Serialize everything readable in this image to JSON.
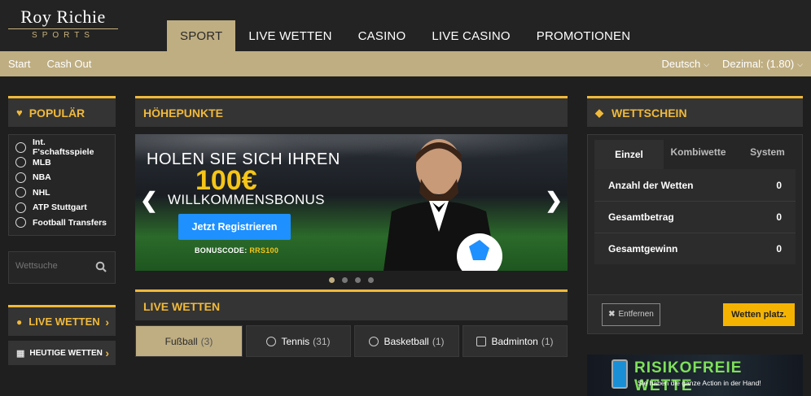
{
  "brand": {
    "name": "Roy Richie",
    "sub": "SPORTS"
  },
  "main_nav": [
    "SPORT",
    "LIVE WETTEN",
    "CASINO",
    "LIVE CASINO",
    "PROMOTIONEN"
  ],
  "sub_nav": {
    "left": [
      "Start",
      "Cash Out"
    ],
    "language": "Deutsch",
    "odds_format": "Dezimal: (1.80)"
  },
  "left": {
    "popular_title": "POPULÄR",
    "popular": [
      {
        "label": "Int. F'schaftsspiele",
        "icon": "soccer-ball-icon"
      },
      {
        "label": "MLB",
        "icon": "baseball-icon"
      },
      {
        "label": "NBA",
        "icon": "basketball-icon"
      },
      {
        "label": "NHL",
        "icon": "hockey-puck-icon"
      },
      {
        "label": "ATP Stuttgart",
        "icon": "tennis-ball-icon"
      },
      {
        "label": "Football Transfers",
        "icon": "soccer-ball-icon"
      }
    ],
    "search_placeholder": "Wettsuche",
    "live_btn": "LIVE WETTEN",
    "today_btn": "HEUTIGE WETTEN"
  },
  "center": {
    "highlights_title": "HÖHEPUNKTE",
    "banner": {
      "title": "HOLEN SIE SICH IHREN",
      "amount": "100€",
      "subtitle": "WILLKOMMENSBONUS",
      "cta": "Jetzt Registrieren",
      "bonus_label": "BONUSCODE:",
      "bonus_code": "RRS100"
    },
    "slides": 4,
    "live_title": "LIVE WETTEN",
    "sports": [
      {
        "name": "Fußball",
        "count": "(3)",
        "active": true
      },
      {
        "name": "Tennis",
        "count": "(31)"
      },
      {
        "name": "Basketball",
        "count": "(1)"
      },
      {
        "name": "Badminton",
        "count": "(1)"
      }
    ]
  },
  "right": {
    "betslip_title": "WETTSCHEIN",
    "tabs": [
      "Einzel",
      "Kombiwette",
      "System"
    ],
    "rows": [
      {
        "label": "Anzahl der Wetten",
        "value": "0"
      },
      {
        "label": "Gesamtbetrag",
        "value": "0"
      },
      {
        "label": "Gesamtgewinn",
        "value": "0"
      }
    ],
    "remove_btn": "Entfernen",
    "place_btn": "Wetten platz.",
    "promo_title": "RISIKOFREIE WETTE",
    "promo_sub": "Sie haben die ganze Action in der Hand!"
  },
  "colors": {
    "gold": "#bfae82",
    "accent": "#f0b93a",
    "cta": "#1e90ff",
    "place": "#f5b301"
  }
}
